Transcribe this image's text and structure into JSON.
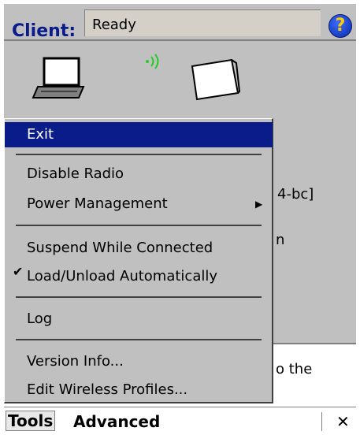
{
  "header": {
    "label": "Client:",
    "status": "Ready",
    "help_icon": "help-icon"
  },
  "background_text": {
    "line1": "4-bc]",
    "line2": "n",
    "line3": "o the"
  },
  "menu": {
    "exit": "Exit",
    "disable_radio": "Disable Radio",
    "power_management": "Power Management",
    "suspend": "Suspend While Connected",
    "load_unload": "Load/Unload Automatically",
    "log": "Log",
    "version_info": "Version Info...",
    "edit_profiles": "Edit Wireless Profiles..."
  },
  "menubar": {
    "tools": "Tools",
    "advanced": "Advanced",
    "close": "✕"
  },
  "colors": {
    "selection": "#0a1c8a",
    "panel": "#c0c0c0",
    "label": "#0a1c8a"
  }
}
